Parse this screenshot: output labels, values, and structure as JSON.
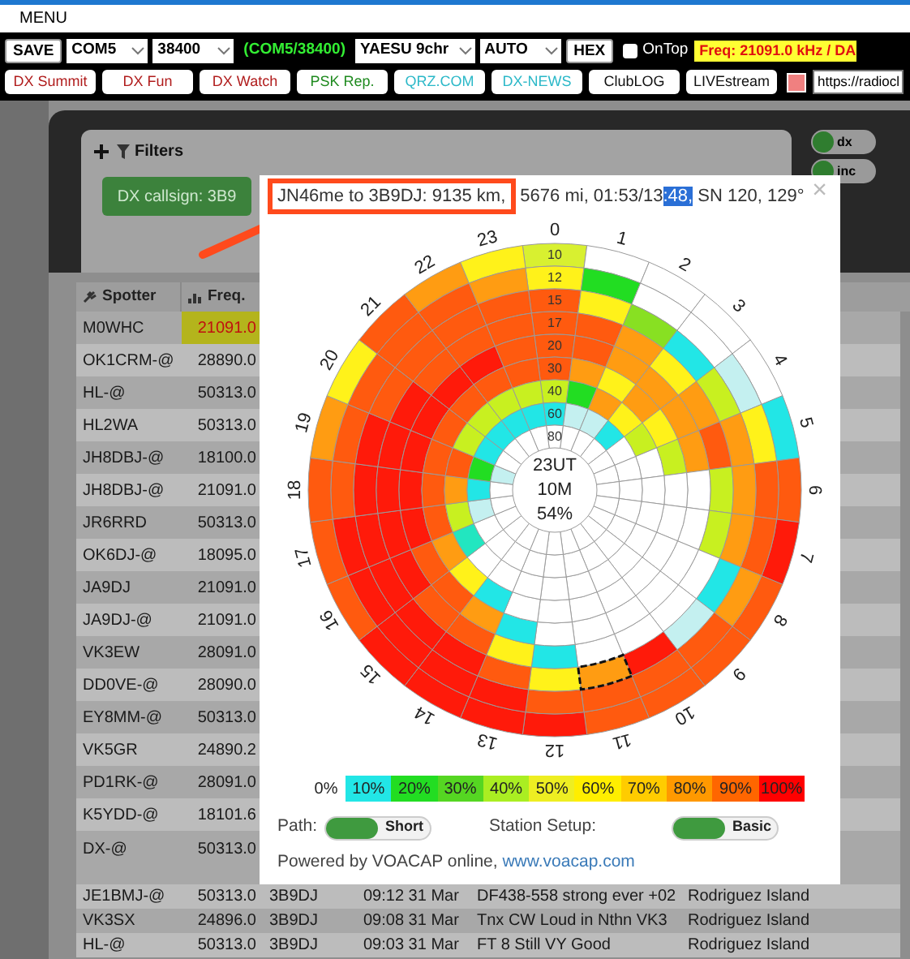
{
  "menu": {
    "label": "MENU"
  },
  "toolbar": {
    "row1": [
      {
        "kind": "button",
        "label": "SAVE"
      },
      {
        "kind": "select",
        "value": "COM5"
      },
      {
        "kind": "select",
        "value": "38400"
      },
      {
        "kind": "status",
        "label": "(COM5/38400)"
      },
      {
        "kind": "select",
        "value": "YAESU 9chr"
      },
      {
        "kind": "select",
        "value": "AUTO"
      },
      {
        "kind": "button",
        "label": "HEX"
      },
      {
        "kind": "checkbox",
        "label": "OnTop",
        "checked": false
      },
      {
        "kind": "readout",
        "label": "Freq: 21091.0 kHz / DA"
      }
    ],
    "row2": [
      {
        "kind": "link",
        "label": "DX Summit",
        "color": "#b01c1c"
      },
      {
        "kind": "link",
        "label": "DX Fun",
        "color": "#b01c1c"
      },
      {
        "kind": "link",
        "label": "DX Watch",
        "color": "#b01c1c"
      },
      {
        "kind": "link",
        "label": "PSK Rep.",
        "color": "#1f8a1f"
      },
      {
        "kind": "link",
        "label": "QRZ.COM",
        "color": "#2bb8c8"
      },
      {
        "kind": "link",
        "label": "DX-NEWS",
        "color": "#2bb8c8"
      },
      {
        "kind": "link",
        "label": "ClubLOG",
        "color": "#111111"
      },
      {
        "kind": "link",
        "label": "LIVEstream",
        "color": "#111111"
      },
      {
        "kind": "swatch",
        "color": "#f08080"
      },
      {
        "kind": "url",
        "value": "https://radiocl"
      }
    ]
  },
  "filters": {
    "title": "Filters",
    "chip": "DX callsign: 3B9",
    "toggles": [
      {
        "label": "dx",
        "on": true
      },
      {
        "label": "inc",
        "on": true
      }
    ]
  },
  "table": {
    "columns": [
      "Spotter",
      "Freq."
    ],
    "rows": [
      {
        "spotter": "M0WHC",
        "freq": "21091.0",
        "highlighted": true
      },
      {
        "spotter": "OK1CRM-@",
        "freq": "28890.0",
        "highlighted": false
      },
      {
        "spotter": "HL-@",
        "freq": "50313.0",
        "highlighted": false
      },
      {
        "spotter": "HL2WA",
        "freq": "50313.0",
        "highlighted": false
      },
      {
        "spotter": "JH8DBJ-@",
        "freq": "18100.0",
        "highlighted": false
      },
      {
        "spotter": "JH8DBJ-@",
        "freq": "21091.0",
        "highlighted": false
      },
      {
        "spotter": "JR6RRD",
        "freq": "50313.0",
        "highlighted": false
      },
      {
        "spotter": "OK6DJ-@",
        "freq": "18095.0",
        "highlighted": false
      },
      {
        "spotter": "JA9DJ",
        "freq": "21091.0",
        "highlighted": false
      },
      {
        "spotter": "JA9DJ-@",
        "freq": "21091.0",
        "highlighted": false
      },
      {
        "spotter": "VK3EW",
        "freq": "28091.0",
        "highlighted": false
      },
      {
        "spotter": "DD0VE-@",
        "freq": "28090.0",
        "highlighted": false
      },
      {
        "spotter": "EY8MM-@",
        "freq": "50313.0",
        "highlighted": false
      },
      {
        "spotter": "VK5GR",
        "freq": "24890.2",
        "highlighted": false
      },
      {
        "spotter": "PD1RK-@",
        "freq": "28091.0",
        "highlighted": false
      },
      {
        "spotter": "K5YDD-@",
        "freq": "18101.6",
        "highlighted": false
      },
      {
        "spotter": "DX-@",
        "freq": "50313.0",
        "highlighted": false
      },
      {
        "spotter": "JE1BMJ-@",
        "freq": "50313.0",
        "dx": "3B9DJ",
        "time": "09:12 31 Mar",
        "comment": "DF438-558 strong ever +02",
        "country": "Rodriguez Island",
        "highlighted": false
      },
      {
        "spotter": "VK3SX",
        "freq": "24896.0",
        "dx": "3B9DJ",
        "time": "09:08 31 Mar",
        "comment": "Tnx CW Loud in Nthn VK3",
        "country": "Rodriguez Island",
        "highlighted": false
      },
      {
        "spotter": "HL-@",
        "freq": "50313.0",
        "dx": "3B9DJ",
        "time": "09:03 31 Mar",
        "comment": "FT 8 Still VY Good",
        "country": "Rodriguez Island",
        "highlighted": false
      }
    ]
  },
  "popup": {
    "header": [
      {
        "text": "JN46me to 3B9DJ: 9135 km,",
        "boxed": true,
        "selected": false
      },
      {
        "text": " 5676 mi, 01:53/13",
        "boxed": false,
        "selected": false
      },
      {
        "text": ":48,",
        "boxed": false,
        "selected": true
      },
      {
        "text": " SN 120, 129°",
        "boxed": false,
        "selected": false
      }
    ],
    "close": "×",
    "chart": {
      "center": [
        "23UT",
        "10M",
        "54%"
      ],
      "rings": [
        "10",
        "12",
        "15",
        "17",
        "20",
        "30",
        "40",
        "60",
        "80"
      ],
      "hours": [
        {
          "label": "0",
          "cells": [
            {
              "color": "#d8f030",
              "selected": false
            },
            {
              "color": "#fff21a",
              "selected": false
            },
            {
              "color": "#ff5a0f",
              "selected": false
            },
            {
              "color": "#ff5a0f",
              "selected": false
            },
            {
              "color": "#ff5a0f",
              "selected": false
            },
            {
              "color": "#ff5a0f",
              "selected": false
            },
            {
              "color": "#c8f020",
              "selected": false
            },
            {
              "color": "#22e6e6",
              "selected": false
            },
            {
              "color": "#ffffff",
              "selected": false
            }
          ]
        },
        {
          "label": "1",
          "cells": [
            {
              "color": "#ffffff",
              "selected": false
            },
            {
              "color": "#22dd22",
              "selected": false
            },
            {
              "color": "#fff21a",
              "selected": false
            },
            {
              "color": "#ff5a0f",
              "selected": false
            },
            {
              "color": "#ff5a0f",
              "selected": false
            },
            {
              "color": "#ff9c12",
              "selected": false
            },
            {
              "color": "#22dd22",
              "selected": false
            },
            {
              "color": "#c4f0f0",
              "selected": false
            },
            {
              "color": "#ffffff",
              "selected": false
            }
          ]
        },
        {
          "label": "2",
          "cells": [
            {
              "color": "#ffffff",
              "selected": false
            },
            {
              "color": "#ffffff",
              "selected": false
            },
            {
              "color": "#88e022",
              "selected": false
            },
            {
              "color": "#ff9c12",
              "selected": false
            },
            {
              "color": "#ff9c12",
              "selected": false
            },
            {
              "color": "#fff21a",
              "selected": false
            },
            {
              "color": "#ff9c12",
              "selected": false
            },
            {
              "color": "#c4f0f0",
              "selected": false
            },
            {
              "color": "#ffffff",
              "selected": false
            }
          ]
        },
        {
          "label": "3",
          "cells": [
            {
              "color": "#ffffff",
              "selected": false
            },
            {
              "color": "#ffffff",
              "selected": false
            },
            {
              "color": "#22e6e6",
              "selected": false
            },
            {
              "color": "#fff21a",
              "selected": false
            },
            {
              "color": "#ff9c12",
              "selected": false
            },
            {
              "color": "#ff9c12",
              "selected": false
            },
            {
              "color": "#fff21a",
              "selected": false
            },
            {
              "color": "#22e6e6",
              "selected": false
            },
            {
              "color": "#ffffff",
              "selected": false
            }
          ]
        },
        {
          "label": "4",
          "cells": [
            {
              "color": "#ffffff",
              "selected": false
            },
            {
              "color": "#c4f0f0",
              "selected": false
            },
            {
              "color": "#c8f020",
              "selected": false
            },
            {
              "color": "#ff9c12",
              "selected": false
            },
            {
              "color": "#ff9c12",
              "selected": false
            },
            {
              "color": "#fff21a",
              "selected": false
            },
            {
              "color": "#c8f020",
              "selected": false
            },
            {
              "color": "#ffffff",
              "selected": false
            },
            {
              "color": "#ffffff",
              "selected": false
            }
          ]
        },
        {
          "label": "5",
          "cells": [
            {
              "color": "#22e6e6",
              "selected": false
            },
            {
              "color": "#fff21a",
              "selected": false
            },
            {
              "color": "#ff9c12",
              "selected": false
            },
            {
              "color": "#ff5a0f",
              "selected": false
            },
            {
              "color": "#ff9c12",
              "selected": false
            },
            {
              "color": "#c8f020",
              "selected": false
            },
            {
              "color": "#ffffff",
              "selected": false
            },
            {
              "color": "#ffffff",
              "selected": false
            },
            {
              "color": "#ffffff",
              "selected": false
            }
          ]
        },
        {
          "label": "6",
          "cells": [
            {
              "color": "#ff5a0f",
              "selected": false
            },
            {
              "color": "#ff5a0f",
              "selected": false
            },
            {
              "color": "#ff9c12",
              "selected": false
            },
            {
              "color": "#c8f020",
              "selected": false
            },
            {
              "color": "#ffffff",
              "selected": false
            },
            {
              "color": "#ffffff",
              "selected": false
            },
            {
              "color": "#ffffff",
              "selected": false
            },
            {
              "color": "#ffffff",
              "selected": false
            },
            {
              "color": "#ffffff",
              "selected": false
            }
          ]
        },
        {
          "label": "7",
          "cells": [
            {
              "color": "#ff1a0a",
              "selected": false
            },
            {
              "color": "#ff5a0f",
              "selected": false
            },
            {
              "color": "#ff9c12",
              "selected": false
            },
            {
              "color": "#c8f020",
              "selected": false
            },
            {
              "color": "#ffffff",
              "selected": false
            },
            {
              "color": "#ffffff",
              "selected": false
            },
            {
              "color": "#ffffff",
              "selected": false
            },
            {
              "color": "#ffffff",
              "selected": false
            },
            {
              "color": "#ffffff",
              "selected": false
            }
          ]
        },
        {
          "label": "8",
          "cells": [
            {
              "color": "#ff5a0f",
              "selected": false
            },
            {
              "color": "#ff9c12",
              "selected": false
            },
            {
              "color": "#22e6e6",
              "selected": false
            },
            {
              "color": "#ffffff",
              "selected": false
            },
            {
              "color": "#ffffff",
              "selected": false
            },
            {
              "color": "#ffffff",
              "selected": false
            },
            {
              "color": "#ffffff",
              "selected": false
            },
            {
              "color": "#ffffff",
              "selected": false
            },
            {
              "color": "#ffffff",
              "selected": false
            }
          ]
        },
        {
          "label": "9",
          "cells": [
            {
              "color": "#ff5a0f",
              "selected": false
            },
            {
              "color": "#ff5a0f",
              "selected": false
            },
            {
              "color": "#c4f0f0",
              "selected": false
            },
            {
              "color": "#ffffff",
              "selected": false
            },
            {
              "color": "#ffffff",
              "selected": false
            },
            {
              "color": "#ffffff",
              "selected": false
            },
            {
              "color": "#ffffff",
              "selected": false
            },
            {
              "color": "#ffffff",
              "selected": false
            },
            {
              "color": "#ffffff",
              "selected": false
            }
          ]
        },
        {
          "label": "10",
          "cells": [
            {
              "color": "#ff5a0f",
              "selected": false
            },
            {
              "color": "#ff5a0f",
              "selected": false
            },
            {
              "color": "#ff1a0a",
              "selected": false
            },
            {
              "color": "#ffffff",
              "selected": false
            },
            {
              "color": "#ffffff",
              "selected": false
            },
            {
              "color": "#ffffff",
              "selected": false
            },
            {
              "color": "#ffffff",
              "selected": false
            },
            {
              "color": "#ffffff",
              "selected": false
            },
            {
              "color": "#ffffff",
              "selected": false
            }
          ]
        },
        {
          "label": "11",
          "cells": [
            {
              "color": "#ff5a0f",
              "selected": false
            },
            {
              "color": "#ff5a0f",
              "selected": false
            },
            {
              "color": "#ff9c12",
              "selected": true
            },
            {
              "color": "#ffffff",
              "selected": false
            },
            {
              "color": "#ffffff",
              "selected": false
            },
            {
              "color": "#ffffff",
              "selected": false
            },
            {
              "color": "#ffffff",
              "selected": false
            },
            {
              "color": "#ffffff",
              "selected": false
            },
            {
              "color": "#ffffff",
              "selected": false
            }
          ]
        },
        {
          "label": "12",
          "cells": [
            {
              "color": "#ff1a0a",
              "selected": false
            },
            {
              "color": "#ff5a0f",
              "selected": false
            },
            {
              "color": "#fff21a",
              "selected": false
            },
            {
              "color": "#22e6e6",
              "selected": false
            },
            {
              "color": "#ffffff",
              "selected": false
            },
            {
              "color": "#ffffff",
              "selected": false
            },
            {
              "color": "#ffffff",
              "selected": false
            },
            {
              "color": "#ffffff",
              "selected": false
            },
            {
              "color": "#ffffff",
              "selected": false
            }
          ]
        },
        {
          "label": "13",
          "cells": [
            {
              "color": "#ff1a0a",
              "selected": false
            },
            {
              "color": "#ff1a0a",
              "selected": false
            },
            {
              "color": "#ff5a0f",
              "selected": false
            },
            {
              "color": "#fff21a",
              "selected": false
            },
            {
              "color": "#22e6e6",
              "selected": false
            },
            {
              "color": "#ffffff",
              "selected": false
            },
            {
              "color": "#ffffff",
              "selected": false
            },
            {
              "color": "#ffffff",
              "selected": false
            },
            {
              "color": "#ffffff",
              "selected": false
            }
          ]
        },
        {
          "label": "14",
          "cells": [
            {
              "color": "#ff1a0a",
              "selected": false
            },
            {
              "color": "#ff1a0a",
              "selected": false
            },
            {
              "color": "#ff1a0a",
              "selected": false
            },
            {
              "color": "#ff5a0f",
              "selected": false
            },
            {
              "color": "#ff9c12",
              "selected": false
            },
            {
              "color": "#22e6e6",
              "selected": false
            },
            {
              "color": "#ffffff",
              "selected": false
            },
            {
              "color": "#ffffff",
              "selected": false
            },
            {
              "color": "#ffffff",
              "selected": false
            }
          ]
        },
        {
          "label": "15",
          "cells": [
            {
              "color": "#ff1a0a",
              "selected": false
            },
            {
              "color": "#ff1a0a",
              "selected": false
            },
            {
              "color": "#ff1a0a",
              "selected": false
            },
            {
              "color": "#ff5a0f",
              "selected": false
            },
            {
              "color": "#ff5a0f",
              "selected": false
            },
            {
              "color": "#fff21a",
              "selected": false
            },
            {
              "color": "#ffffff",
              "selected": false
            },
            {
              "color": "#ffffff",
              "selected": false
            },
            {
              "color": "#ffffff",
              "selected": false
            }
          ]
        },
        {
          "label": "16",
          "cells": [
            {
              "color": "#ff5a0f",
              "selected": false
            },
            {
              "color": "#ff1a0a",
              "selected": false
            },
            {
              "color": "#ff1a0a",
              "selected": false
            },
            {
              "color": "#ff1a0a",
              "selected": false
            },
            {
              "color": "#ff5a0f",
              "selected": false
            },
            {
              "color": "#ff9c12",
              "selected": false
            },
            {
              "color": "#22e6c0",
              "selected": false
            },
            {
              "color": "#ffffff",
              "selected": false
            },
            {
              "color": "#ffffff",
              "selected": false
            }
          ]
        },
        {
          "label": "17",
          "cells": [
            {
              "color": "#ff5a0f",
              "selected": false
            },
            {
              "color": "#ff1a0a",
              "selected": false
            },
            {
              "color": "#ff1a0a",
              "selected": false
            },
            {
              "color": "#ff1a0a",
              "selected": false
            },
            {
              "color": "#ff1a0a",
              "selected": false
            },
            {
              "color": "#ff5a0f",
              "selected": false
            },
            {
              "color": "#c8f020",
              "selected": false
            },
            {
              "color": "#c4f0f0",
              "selected": false
            },
            {
              "color": "#ffffff",
              "selected": false
            }
          ]
        },
        {
          "label": "18",
          "cells": [
            {
              "color": "#ff5a0f",
              "selected": false
            },
            {
              "color": "#ff5a0f",
              "selected": false
            },
            {
              "color": "#ff1a0a",
              "selected": false
            },
            {
              "color": "#ff1a0a",
              "selected": false
            },
            {
              "color": "#ff1a0a",
              "selected": false
            },
            {
              "color": "#ff5a0f",
              "selected": false
            },
            {
              "color": "#ff9c12",
              "selected": false
            },
            {
              "color": "#22e6e6",
              "selected": false
            },
            {
              "color": "#ffffff",
              "selected": false
            }
          ]
        },
        {
          "label": "19",
          "cells": [
            {
              "color": "#ff9c12",
              "selected": false
            },
            {
              "color": "#ff5a0f",
              "selected": false
            },
            {
              "color": "#ff1a0a",
              "selected": false
            },
            {
              "color": "#ff1a0a",
              "selected": false
            },
            {
              "color": "#ff1a0a",
              "selected": false
            },
            {
              "color": "#ff5a0f",
              "selected": false
            },
            {
              "color": "#ff5a0f",
              "selected": false
            },
            {
              "color": "#22dd22",
              "selected": false
            },
            {
              "color": "#c4f0f0",
              "selected": false
            }
          ]
        },
        {
          "label": "20",
          "cells": [
            {
              "color": "#fff21a",
              "selected": false
            },
            {
              "color": "#ff5a0f",
              "selected": false
            },
            {
              "color": "#ff5a0f",
              "selected": false
            },
            {
              "color": "#ff1a0a",
              "selected": false
            },
            {
              "color": "#ff1a0a",
              "selected": false
            },
            {
              "color": "#ff5a0f",
              "selected": false
            },
            {
              "color": "#c8f020",
              "selected": false
            },
            {
              "color": "#22e6e6",
              "selected": false
            },
            {
              "color": "#ffffff",
              "selected": false
            }
          ]
        },
        {
          "label": "21",
          "cells": [
            {
              "color": "#ff5a0f",
              "selected": false
            },
            {
              "color": "#ff5a0f",
              "selected": false
            },
            {
              "color": "#ff5a0f",
              "selected": false
            },
            {
              "color": "#ff5a0f",
              "selected": false
            },
            {
              "color": "#ff1a0a",
              "selected": false
            },
            {
              "color": "#ff5a0f",
              "selected": false
            },
            {
              "color": "#c8f020",
              "selected": false
            },
            {
              "color": "#22e6e6",
              "selected": false
            },
            {
              "color": "#ffffff",
              "selected": false
            }
          ]
        },
        {
          "label": "22",
          "cells": [
            {
              "color": "#ff9c12",
              "selected": false
            },
            {
              "color": "#ff5a0f",
              "selected": false
            },
            {
              "color": "#ff5a0f",
              "selected": false
            },
            {
              "color": "#ff5a0f",
              "selected": false
            },
            {
              "color": "#ff1a0a",
              "selected": false
            },
            {
              "color": "#ff5a0f",
              "selected": false
            },
            {
              "color": "#c8f020",
              "selected": false
            },
            {
              "color": "#22e6e6",
              "selected": false
            },
            {
              "color": "#ffffff",
              "selected": false
            }
          ]
        },
        {
          "label": "23",
          "cells": [
            {
              "color": "#fff21a",
              "selected": false
            },
            {
              "color": "#ff9c12",
              "selected": false
            },
            {
              "color": "#ff5a0f",
              "selected": false
            },
            {
              "color": "#ff5a0f",
              "selected": false
            },
            {
              "color": "#ff5a0f",
              "selected": false
            },
            {
              "color": "#ff5a0f",
              "selected": false
            },
            {
              "color": "#c8f020",
              "selected": false
            },
            {
              "color": "#22e6e6",
              "selected": false
            },
            {
              "color": "#ffffff",
              "selected": false
            }
          ]
        }
      ]
    },
    "legend": [
      {
        "label": "0%"
      },
      {
        "label": "10%",
        "color": "#22e6e6"
      },
      {
        "label": "20%",
        "color": "#22dd22"
      },
      {
        "label": "30%",
        "color": "#55d622"
      },
      {
        "label": "40%",
        "color": "#aaee22"
      },
      {
        "label": "50%",
        "color": "#eeee22"
      },
      {
        "label": "60%",
        "color": "#ffee00"
      },
      {
        "label": "70%",
        "color": "#ffcc00"
      },
      {
        "label": "80%",
        "color": "#ff9900"
      },
      {
        "label": "90%",
        "color": "#ff6600"
      },
      {
        "label": "100%",
        "color": "#ff0000"
      }
    ],
    "switches": [
      {
        "label": "Path:",
        "value": "Short",
        "on": true
      },
      {
        "label": "Station Setup:",
        "value": "Basic",
        "on": true
      }
    ],
    "footer": {
      "text": "Powered by VOACAP online,",
      "link": "www.voacap.com"
    }
  }
}
